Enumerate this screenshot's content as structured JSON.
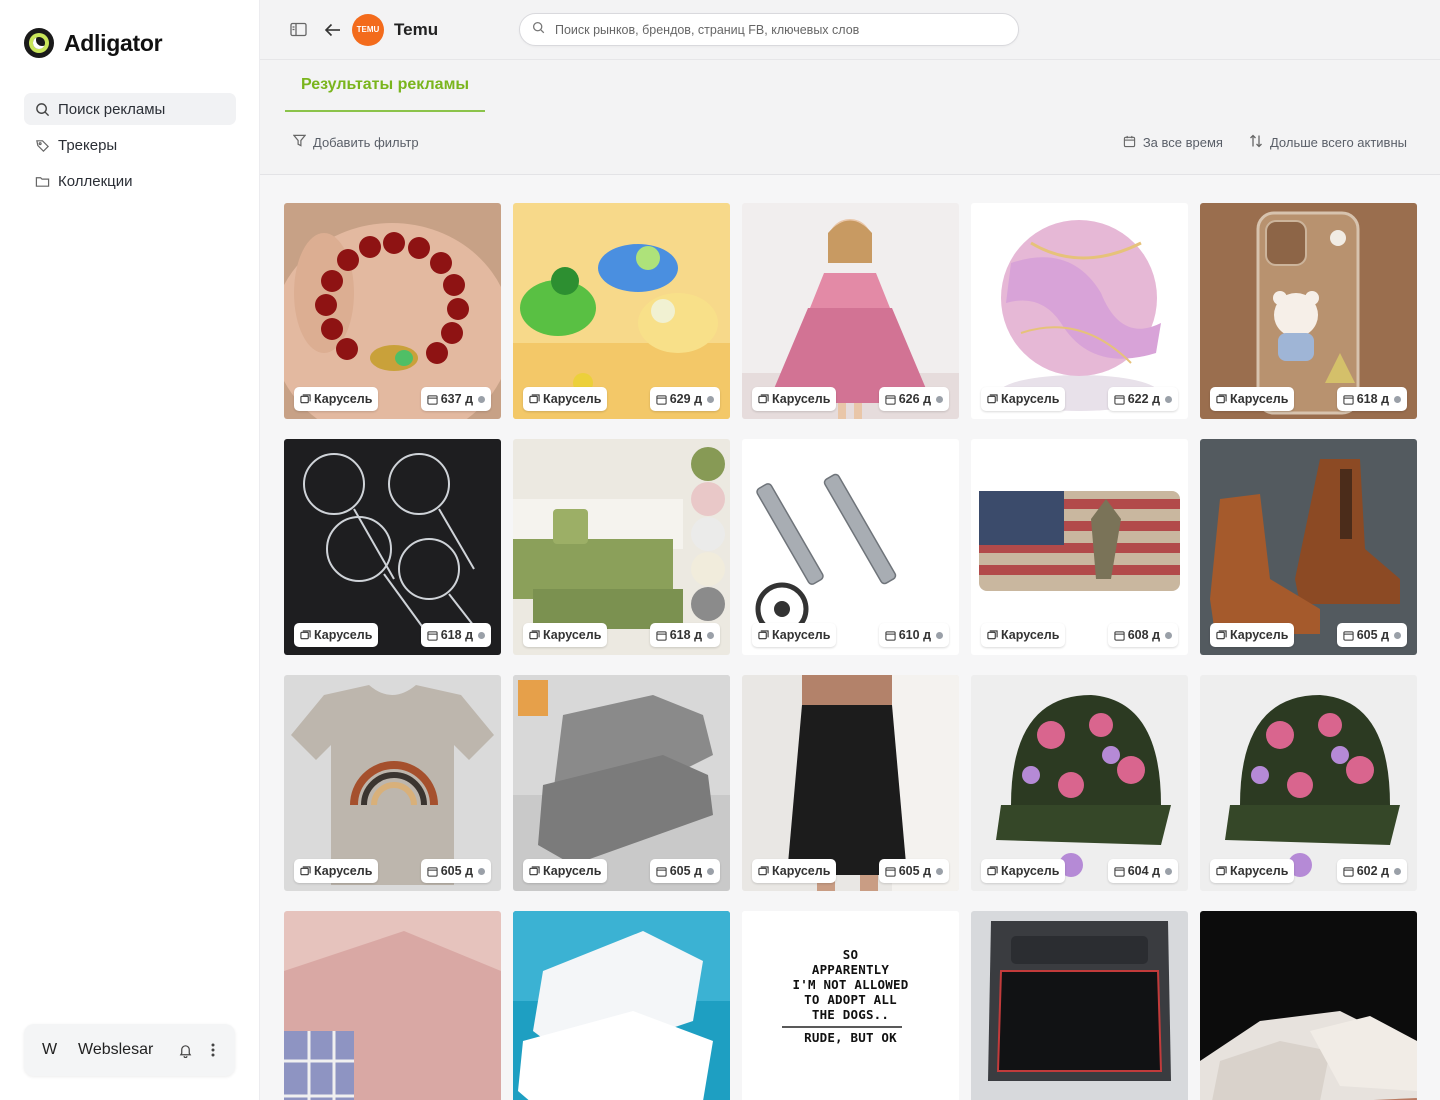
{
  "app": {
    "logo_text": "Adligator"
  },
  "sidebar": {
    "items": [
      {
        "label": "Поиск рекламы",
        "icon": "search-icon",
        "active": true
      },
      {
        "label": "Трекеры",
        "icon": "tag-icon",
        "active": false
      },
      {
        "label": "Коллекции",
        "icon": "folder-icon",
        "active": false
      }
    ],
    "user": {
      "initial": "W",
      "name": "Webslesar"
    }
  },
  "header": {
    "brand_logo_text": "TEMU",
    "brand_name": "Temu",
    "search_placeholder": "Поиск рынков, брендов, страниц FB, ключевых слов"
  },
  "tabs": {
    "active_label": "Результаты рекламы"
  },
  "filters": {
    "add_filter": "Добавить фильтр",
    "time_range": "За все время",
    "sort": "Дольше всего активны"
  },
  "ads": [
    {
      "type": "Карусель",
      "days": "637 д",
      "image": "red bead bracelet in palm"
    },
    {
      "type": "Карусель",
      "days": "629 д",
      "image": "kids clogs"
    },
    {
      "type": "Карусель",
      "days": "626 д",
      "image": "girl in pink dress"
    },
    {
      "type": "Карусель",
      "days": "622 д",
      "image": "pink marble coaster"
    },
    {
      "type": "Карусель",
      "days": "618 д",
      "image": "clear phone case with bear"
    },
    {
      "type": "Карусель",
      "days": "618 д",
      "image": "wire skimmer set"
    },
    {
      "type": "Карусель",
      "days": "618 д",
      "image": "green sofa cover"
    },
    {
      "type": "Карусель",
      "days": "610 д",
      "image": "fishing rod clamps"
    },
    {
      "type": "Карусель",
      "days": "608 д",
      "image": "american flag license plate"
    },
    {
      "type": "Карусель",
      "days": "605 д",
      "image": "brown chelsea boots"
    },
    {
      "type": "Карусель",
      "days": "605 д",
      "image": "rainbow t-shirt"
    },
    {
      "type": "Карусель",
      "days": "605 д",
      "image": "grey knit sneakers"
    },
    {
      "type": "Карусель",
      "days": "605 д",
      "image": "black satin skirt"
    },
    {
      "type": "Карусель",
      "days": "604 д",
      "image": "floral baseball cap"
    },
    {
      "type": "Карусель",
      "days": "602 д",
      "image": "floral baseball cap"
    },
    {
      "type": "",
      "days": "",
      "image": "pink sweater"
    },
    {
      "type": "",
      "days": "",
      "image": "white sneakers"
    },
    {
      "type": "",
      "days": "",
      "image": "printed white t-shirt"
    },
    {
      "type": "",
      "days": "",
      "image": "car trunk mat"
    },
    {
      "type": "",
      "days": "",
      "image": "white slip-on shoes"
    }
  ],
  "tshirt_print": [
    "SO",
    "APPARENTLY",
    "I'M NOT ALLOWED",
    "TO ADOPT ALL",
    "THE DOGS..",
    "RUDE, BUT OK"
  ],
  "colors": {
    "accent": "#7ab51d",
    "brand": "#f36b1c"
  }
}
